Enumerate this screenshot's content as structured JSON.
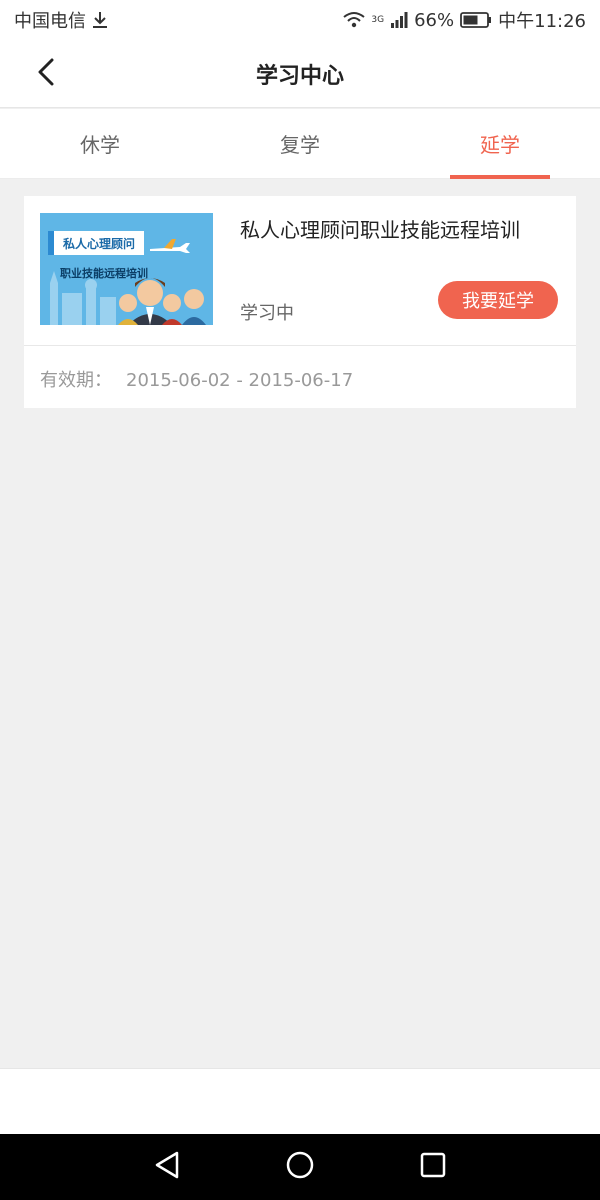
{
  "status_bar": {
    "carrier": "中国电信",
    "network_label": "3G",
    "battery": "66%",
    "time": "中午11:26"
  },
  "header": {
    "title": "学习中心",
    "back_icon": "chevron-left-icon"
  },
  "tabs": [
    {
      "label": "休学",
      "active": false
    },
    {
      "label": "复学",
      "active": false
    },
    {
      "label": "延学",
      "active": true
    }
  ],
  "course": {
    "thumb_title": "私人心理顾问",
    "thumb_subtitle": "职业技能远程培训",
    "title": "私人心理顾问职业技能远程培训",
    "status": "学习中",
    "action_label": "我要延学",
    "validity_label": "有效期：",
    "validity_range": "2015-06-02 - 2015-06-17"
  },
  "colors": {
    "accent": "#f0644f",
    "background": "#f0f0f0"
  },
  "nav_icons": [
    "back-triangle-icon",
    "home-circle-icon",
    "recents-square-icon"
  ]
}
